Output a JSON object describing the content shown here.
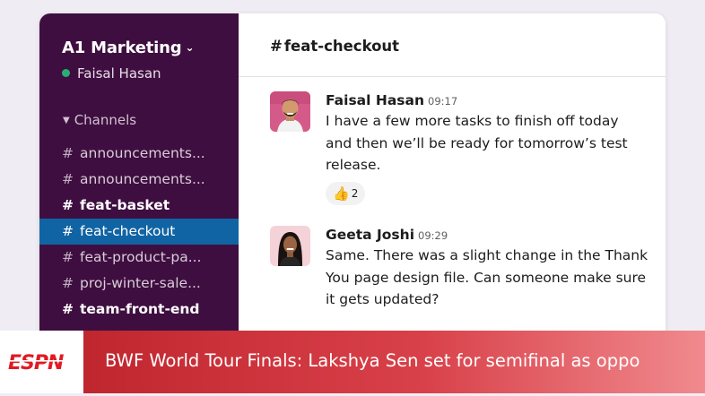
{
  "workspace": {
    "name": "A1 Marketing",
    "user": "Faisal Hasan"
  },
  "sidebar": {
    "section_label": "Channels",
    "channels": [
      {
        "label": "announcements..."
      },
      {
        "label": "announcements..."
      },
      {
        "label": "feat-basket"
      },
      {
        "label": "feat-checkout"
      },
      {
        "label": "feat-product-pa..."
      },
      {
        "label": "proj-winter-sale..."
      },
      {
        "label": "team-front-end"
      }
    ]
  },
  "channel_header": {
    "title": "feat-checkout"
  },
  "messages": [
    {
      "sender": "Faisal Hasan",
      "time": "09:17",
      "text": "I have a few more tasks to finish off today and then we’ll be ready for tomorrow’s test release.",
      "reaction": {
        "emoji": "👍",
        "count": "2"
      }
    },
    {
      "sender": "Geeta Joshi",
      "time": "09:29",
      "text": "Same. There was a slight change in the Thank You page design file. Can someone make sure it gets updated?"
    }
  ],
  "banner": {
    "logo_text": "ESPN",
    "headline": "BWF World Tour Finals: Lakshya Sen set for semifinal as oppo"
  },
  "colors": {
    "sidebar_bg": "#3f0e40",
    "active_channel": "#1164a3",
    "presence": "#2bac76",
    "banner_red": "#c0262e",
    "espn_red": "#e01a22"
  }
}
